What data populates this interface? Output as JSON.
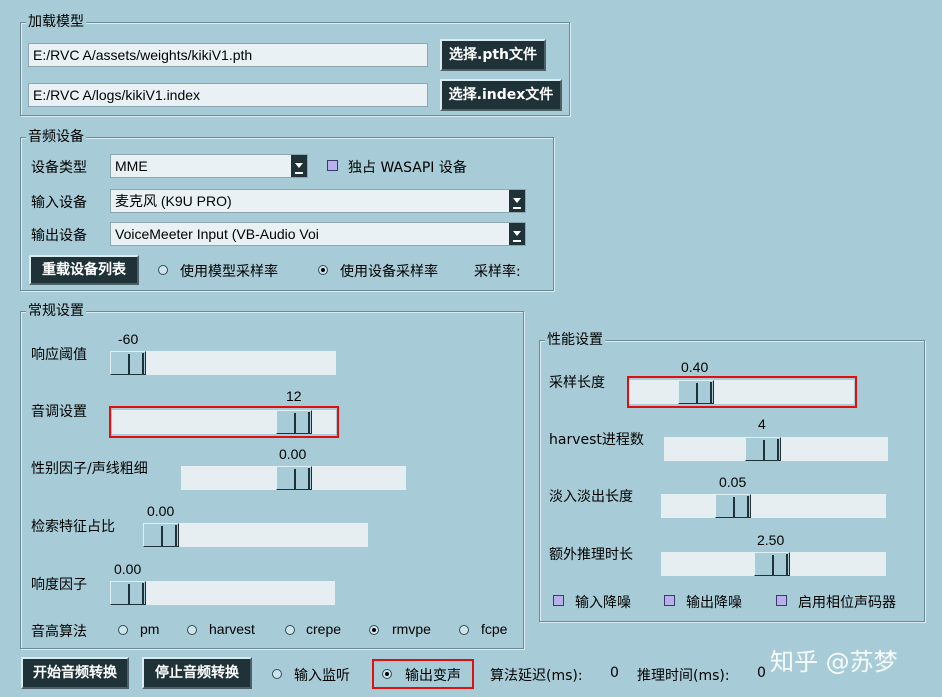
{
  "load_model": {
    "title": "加载模型",
    "pth_path": "E:/RVC A/assets/weights/kikiV1.pth",
    "index_path": "E:/RVC A/logs/kikiV1.index",
    "pth_button": "选择.pth文件",
    "index_button": "选择.index文件"
  },
  "audio_device": {
    "title": "音频设备",
    "device_type_label": "设备类型",
    "device_type_value": "MME",
    "wasapi_label": "独占 WASAPI 设备",
    "input_label": "输入设备",
    "input_value": "麦克风 (K9U PRO)",
    "output_label": "输出设备",
    "output_value": "VoiceMeeter Input (VB-Audio Voi",
    "reload_button": "重载设备列表",
    "radio_model_sr": "使用模型采样率",
    "radio_device_sr": "使用设备采样率",
    "selected_sr": "device",
    "sample_rate_label": "采样率:"
  },
  "general": {
    "title": "常规设置",
    "threshold_label": "响应阈值",
    "threshold_value": "-60",
    "pitch_label": "音调设置",
    "pitch_value": "12",
    "formant_label": "性别因子/声线粗细",
    "formant_value": "0.00",
    "index_rate_label": "检索特征占比",
    "index_rate_value": "0.00",
    "rms_label": "响度因子",
    "rms_value": "0.00",
    "f0_label": "音高算法",
    "f0_options": [
      "pm",
      "harvest",
      "crepe",
      "rmvpe",
      "fcpe"
    ],
    "f0_selected": "rmvpe"
  },
  "performance": {
    "title": "性能设置",
    "block_label": "采样长度",
    "block_value": "0.40",
    "harvest_label": "harvest进程数",
    "harvest_value": "4",
    "crossfade_label": "淡入淡出长度",
    "crossfade_value": "0.05",
    "extra_label": "额外推理时长",
    "extra_value": "2.50",
    "input_denoise": "输入降噪",
    "output_denoise": "输出降噪",
    "phase_vocoder": "启用相位声码器"
  },
  "bottom": {
    "start_button": "开始音频转换",
    "stop_button": "停止音频转换",
    "input_monitor": "输入监听",
    "output_voice": "输出变声",
    "selected_output": "output",
    "delay_label": "算法延迟(ms):",
    "delay_value": "0",
    "infer_label": "推理时间(ms):",
    "infer_value": "0"
  },
  "watermark": "知乎 @苏梦"
}
